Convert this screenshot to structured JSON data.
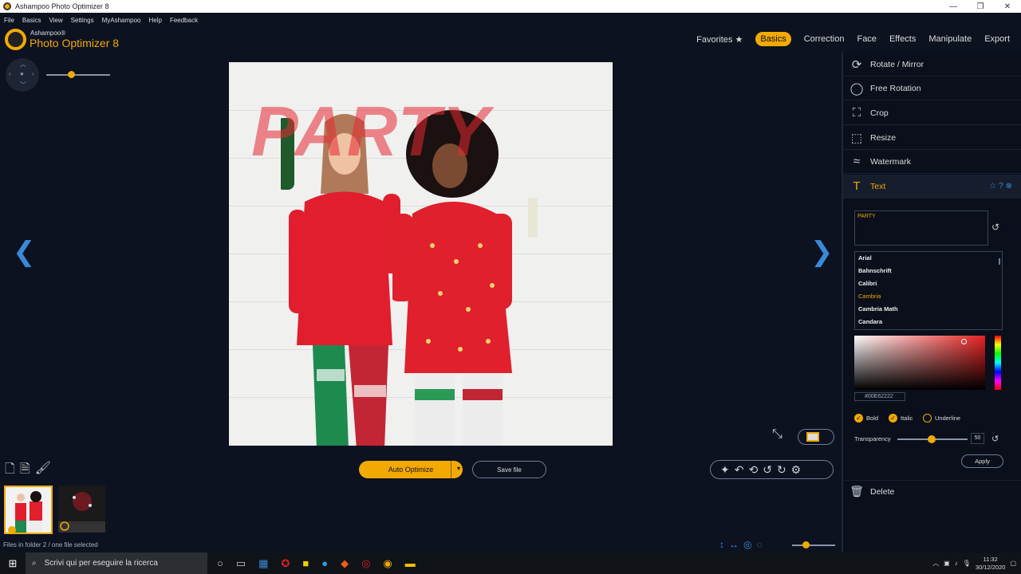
{
  "window": {
    "title": "Ashampoo Photo Optimizer 8",
    "controls": [
      "—",
      "❐",
      "✕"
    ]
  },
  "menu": [
    "File",
    "Basics",
    "View",
    "Settings",
    "MyAshampoo",
    "Help",
    "Feedback"
  ],
  "brand": {
    "small": "Ashampoo®",
    "big": "Photo Optimizer 8"
  },
  "topnav": [
    "Favorites ★",
    "Basics",
    "Correction",
    "Face",
    "Effects",
    "Manipulate",
    "Export"
  ],
  "overlay_text": "PARTY",
  "bottom": {
    "auto_optimize": "Auto Optimize",
    "save_file": "Save file"
  },
  "status": {
    "text": "Files in folder 2 / one file selected"
  },
  "panel": {
    "items": [
      "Rotate / Mirror",
      "Free Rotation",
      "Crop",
      "Resize",
      "Watermark",
      "Text"
    ],
    "text_value": "PARTY",
    "fonts": [
      "Arial",
      "Bahnschrift",
      "Calibri",
      "Cambria",
      "Cambria Math",
      "Candara"
    ],
    "selected_font": "Cambria",
    "color_hex": "#00E62222",
    "bold": "Bold",
    "italic": "Italic",
    "underline": "Underline",
    "transparency_label": "Transparency",
    "transparency_value": "50",
    "transparency_level_percent": 50,
    "apply": "Apply",
    "delete": "Delete"
  },
  "taskbar": {
    "search_placeholder": "Scrivi qui per eseguire la ricerca",
    "time": "11:32",
    "date": "30/12/2020"
  },
  "colors": {
    "accent": "#f2a900",
    "link": "#3a89d8",
    "bg": "#0c1220"
  }
}
